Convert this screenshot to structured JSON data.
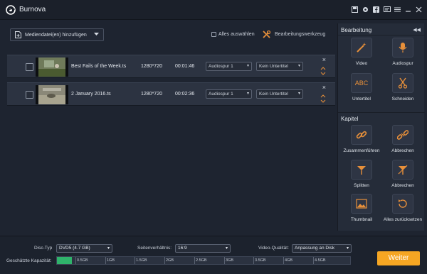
{
  "app": {
    "title": "Burnova"
  },
  "titlebar": {
    "icons": [
      "save-icon",
      "settings-icon",
      "facebook-icon",
      "message-icon",
      "menu-icon",
      "minimize-icon",
      "close-icon"
    ]
  },
  "toolbar": {
    "add_label": "Mediendatei(en) hinzufügen",
    "select_all_label": "Alles auswählen",
    "editor_label": "Bearbeitungswerkzeug"
  },
  "files": [
    {
      "name": "Best Fails of the Week.ts",
      "resolution": "1280*720",
      "duration": "00:01:46",
      "audio": "Audiospur 1",
      "subtitle": "Kein Untertitel"
    },
    {
      "name": "2 January 2016.ts",
      "resolution": "1280*720",
      "duration": "00:02:36",
      "audio": "Audiospur 1",
      "subtitle": "Kein Untertitel"
    }
  ],
  "panel": {
    "collapse_glyph": "◀◀",
    "edit_title": "Bearbeitung",
    "edit_tools": [
      {
        "label": "Video",
        "icon": "magic-wand-icon"
      },
      {
        "label": "Audiospur",
        "icon": "microphone-icon"
      },
      {
        "label": "Untertitel",
        "icon": "subtitle-icon",
        "box_text": "ABC"
      },
      {
        "label": "Schneiden",
        "icon": "scissors-icon"
      }
    ],
    "chapter_title": "Kapitel",
    "chapter_tools": [
      {
        "label": "Zusammenführen",
        "icon": "link-icon"
      },
      {
        "label": "Abbrechen",
        "icon": "unlink-icon"
      },
      {
        "label": "Splitten",
        "icon": "split-icon"
      },
      {
        "label": "Abbrechen",
        "icon": "cancel-split-icon"
      },
      {
        "label": "Thumbnail",
        "icon": "thumbnail-icon"
      },
      {
        "label": "Alles zurücksetzen",
        "icon": "reset-icon"
      }
    ]
  },
  "footer": {
    "disc_type_label": "Disc-Typ",
    "disc_type_value": "DVD5 (4.7 GB)",
    "aspect_label": "Seitenverhältnis:",
    "aspect_value": "16:9",
    "quality_label": "Video-Qualität:",
    "quality_value": "Anpassung an Disk",
    "capacity_label": "Geschätzte Kapazität:",
    "capacity_used_fraction": 0.05,
    "capacity_ticks": [
      "0.5GB",
      "1GB",
      "1.5GB",
      "2GB",
      "2.5GB",
      "3GB",
      "3.5GB",
      "4GB",
      "4.5GB"
    ],
    "next_label": "Weiter"
  },
  "colors": {
    "accent": "#f5a623",
    "capacity": "#2fb36b",
    "icon": "#e8903a",
    "background": "#1e2430"
  }
}
